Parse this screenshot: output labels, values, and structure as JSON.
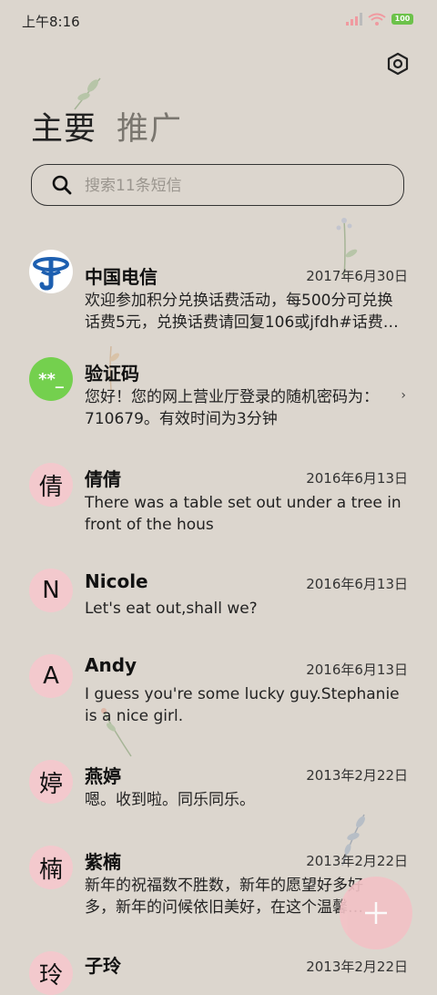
{
  "status": {
    "time": "上午8:16",
    "battery": "100",
    "colors": {
      "signal": "#f09aa0",
      "wifi": "#f09aa0",
      "battery": "#6cc24a"
    }
  },
  "header": {
    "settings_icon": "hexagon-settings-icon",
    "tabs": [
      {
        "label": "主要",
        "active": true
      },
      {
        "label": "推广",
        "active": false
      }
    ]
  },
  "search": {
    "placeholder": "搜索11条短信",
    "value": ""
  },
  "messages": [
    {
      "name": "中国电信",
      "date": "2017年6月30日",
      "preview": "欢迎参加积分兑换话费活动，每500分可兑换话费5元，兑换话费请回复106或jfdh#话费…",
      "avatar": "china-telecom-logo",
      "avatar_color": "#ffffff"
    },
    {
      "name": "验证码",
      "date": "",
      "preview": "您好！您的网上营业厅登录的随机密码为：710679。有效时间为3分钟",
      "avatar": "**_",
      "avatar_color": "#74d04e"
    },
    {
      "name": "倩倩",
      "date": "2016年6月13日",
      "preview": "There was a table set out under a tree in front of the hous",
      "avatar": "倩",
      "avatar_color": "#f3c9cd"
    },
    {
      "name": "Nicole",
      "date": "2016年6月13日",
      "preview": "Let's eat out,shall we?",
      "avatar": "N",
      "avatar_color": "#f3c9cd"
    },
    {
      "name": "Andy",
      "date": "2016年6月13日",
      "preview": "I guess you're some lucky guy.Stephanie is a nice girl.",
      "avatar": "A",
      "avatar_color": "#f3c9cd"
    },
    {
      "name": "燕婷",
      "date": "2013年2月22日",
      "preview": "嗯。收到啦。同乐同乐。",
      "avatar": "婷",
      "avatar_color": "#f3c9cd"
    },
    {
      "name": "紫楠",
      "date": "2013年2月22日",
      "preview": "新年的祝福数不胜数，新年的愿望好多好多，新年的问候依旧美好，在这个温馨的节日",
      "avatar": "楠",
      "avatar_color": "#f3c9cd"
    },
    {
      "name": "子玲",
      "date": "2013年2月22日",
      "preview": "",
      "avatar": "玲",
      "avatar_color": "#f3c9cd"
    }
  ],
  "fab": {
    "icon": "plus-icon",
    "color": "#f3c2c6"
  },
  "colors": {
    "background": "#dcd6ce",
    "accent": "#f3c9cd"
  }
}
